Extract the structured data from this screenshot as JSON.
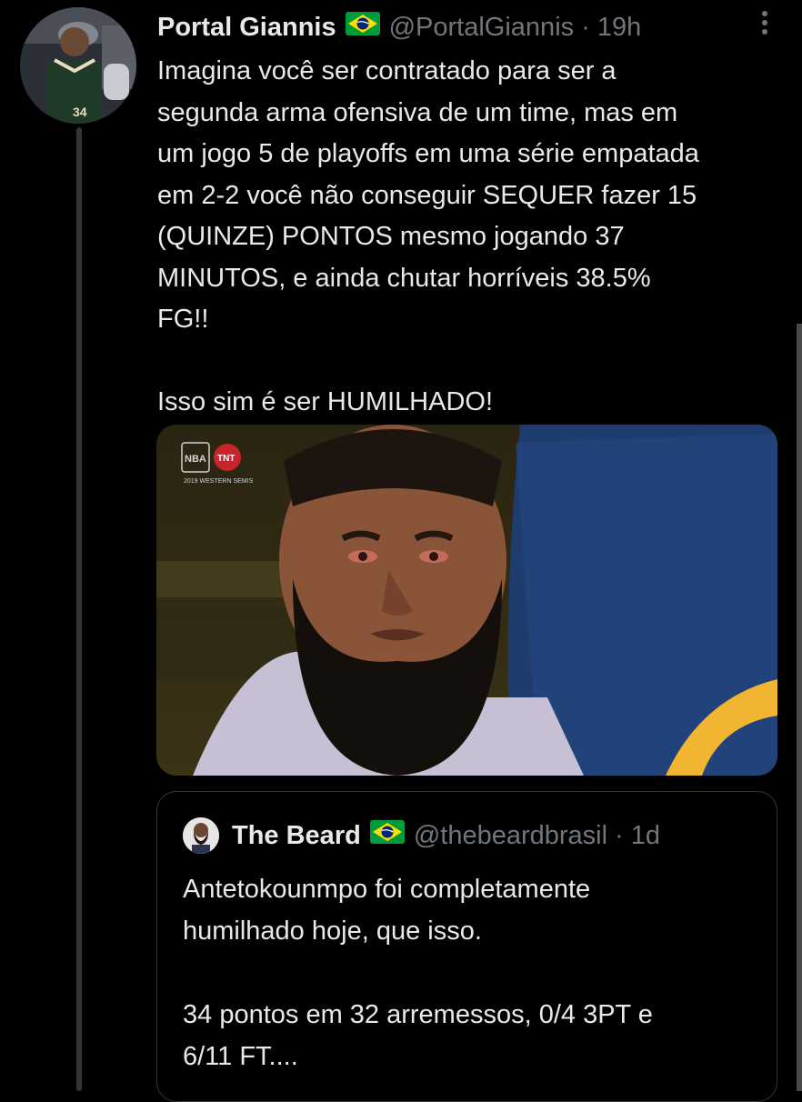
{
  "tweet": {
    "author_name": "Portal Giannis",
    "handle": "@PortalGiannis",
    "separator": "·",
    "time": "19h",
    "lines": [
      "Imagina você ser contratado para ser a",
      "segunda arma ofensiva de um time, mas em",
      "um jogo 5 de playoffs em uma série empatada",
      "em 2-2 você não conseguir SEQUER fazer 15",
      "(QUINZE) PONTOS mesmo jogando 37",
      "MINUTOS, e ainda chutar horríveis 38.5%",
      "FG!!",
      "Isso sim é ser HUMILHADO!"
    ],
    "media": {
      "badge_nba": "NBA",
      "badge_tnt": "TNT",
      "badge_caption": "2019 WESTERN SEMIS"
    },
    "avatar_jersey": "34"
  },
  "quote": {
    "author_name": "The Beard",
    "handle": "@thebeardbrasil",
    "separator": "·",
    "time": "1d",
    "lines": [
      "Antetokounmpo foi completamente",
      "humilhado hoje, que isso.",
      "34 pontos em 32 arremessos, 0/4 3PT e",
      "6/11 FT...."
    ]
  },
  "colors": {
    "background": "#000000",
    "text": "#e7e9ea",
    "secondary": "#71767b",
    "border": "#333639",
    "flag_green": "#009c3b",
    "flag_yellow": "#ffdf00",
    "flag_blue": "#002776"
  },
  "icons": {
    "flag": "brazil-flag-icon",
    "more": "more-vertical-icon"
  }
}
